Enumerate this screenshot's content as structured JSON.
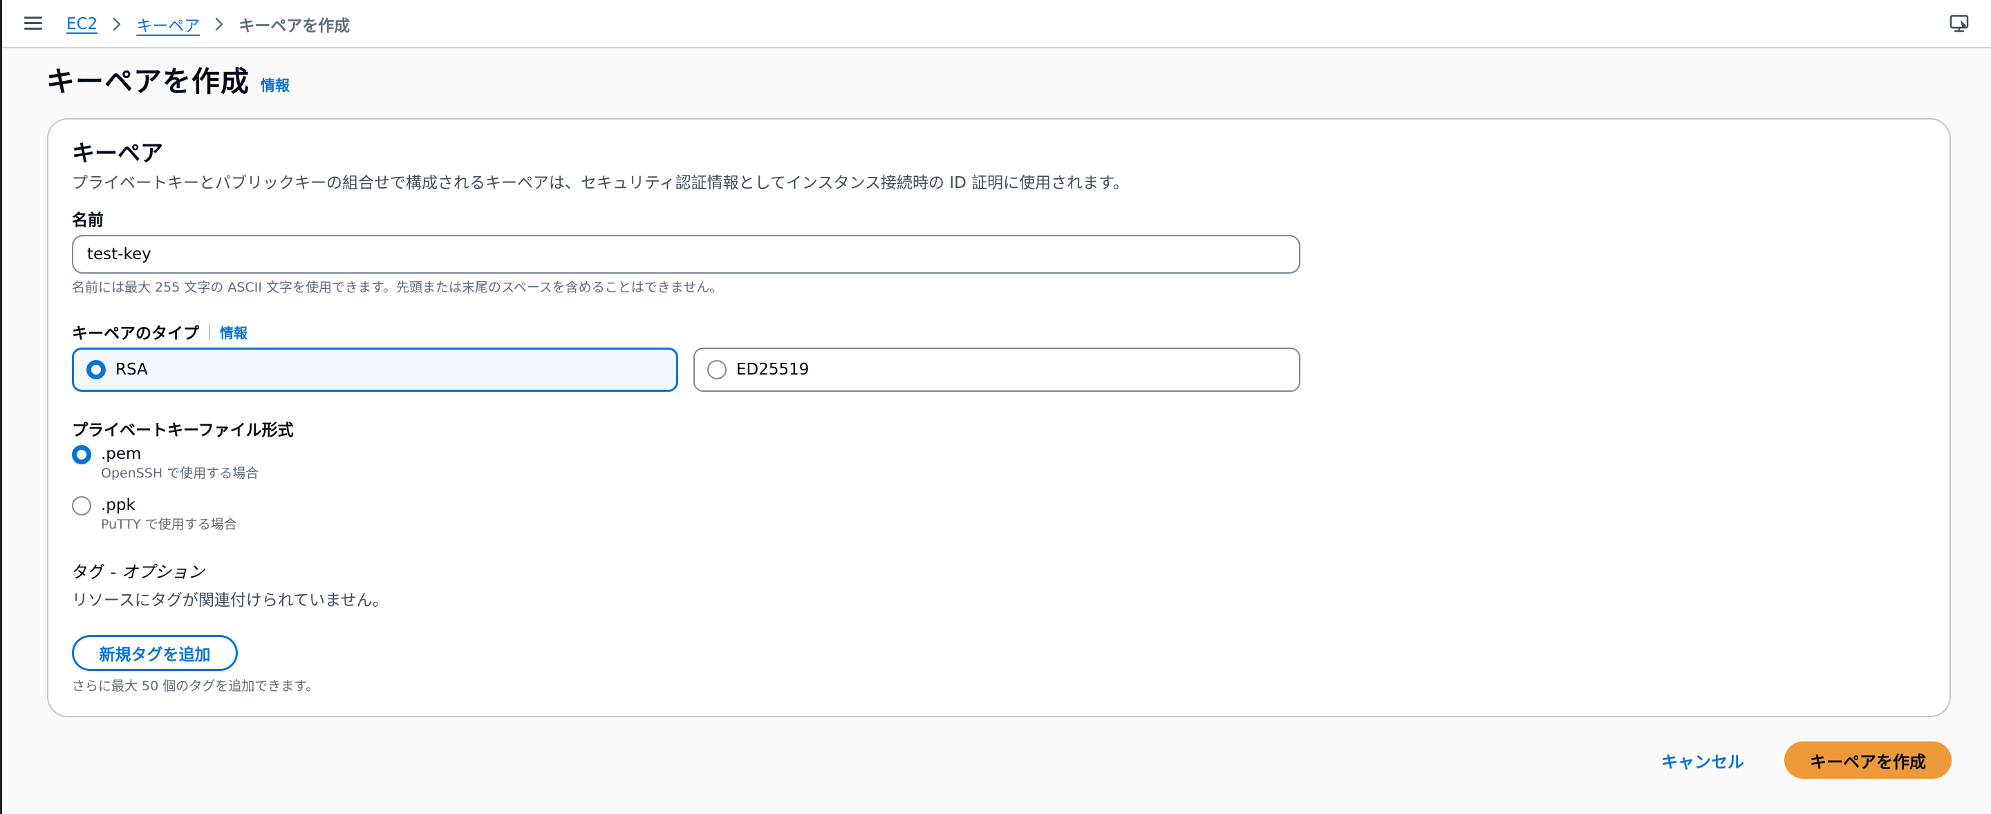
{
  "breadcrumb": {
    "items": [
      {
        "label": "EC2"
      },
      {
        "label": "キーペア"
      }
    ],
    "current": "キーペアを作成"
  },
  "header": {
    "title": "キーペアを作成",
    "info_label": "情報"
  },
  "key_pair": {
    "section_title": "キーペア",
    "description": "プライベートキーとパブリックキーの組合せで構成されるキーペアは、セキュリティ認証情報としてインスタンス接続時の ID 証明に使用されます。",
    "name": {
      "label": "名前",
      "value": "test-key",
      "constraint": "名前には最大 255 文字の ASCII 文字を使用できます。先頭または末尾のスペースを含めることはできません。"
    },
    "type": {
      "label": "キーペアのタイプ",
      "info_label": "情報",
      "options": [
        {
          "label": "RSA",
          "selected": true
        },
        {
          "label": "ED25519",
          "selected": false
        }
      ]
    },
    "file_format": {
      "label": "プライベートキーファイル形式",
      "options": [
        {
          "label": ".pem",
          "description": "OpenSSH で使用する場合",
          "selected": true
        },
        {
          "label": ".ppk",
          "description": "PuTTY で使用する場合",
          "selected": false
        }
      ]
    },
    "tags": {
      "title": "タグ - ",
      "title_optional": "オプション",
      "empty_text": "リソースにタグが関連付けられていません。",
      "add_button": "新規タグを追加",
      "limit_hint": "さらに最大 50 個のタグを追加できます。"
    }
  },
  "footer": {
    "cancel_label": "キャンセル",
    "create_label": "キーペアを作成"
  },
  "colors": {
    "accent": "#0972d3",
    "primary_button": "#ef9a3a",
    "selected_tile_bg": "#f2f8fd"
  },
  "icons": {
    "menu": "hamburger-menu-icon",
    "separator": "chevron-right-icon",
    "top_right": "feedback-icon"
  }
}
